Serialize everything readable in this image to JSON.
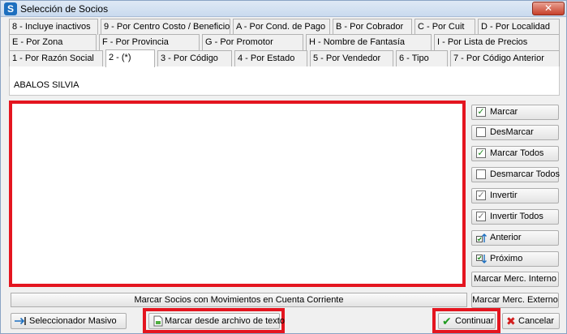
{
  "window": {
    "title": "Selección de Socios",
    "close_label": "✕"
  },
  "tabs": {
    "row1": [
      {
        "label": "8 - Incluye inactivos"
      },
      {
        "label": "9 - Por Centro Costo / Beneficio"
      },
      {
        "label": "A - Por Cond. de Pago"
      },
      {
        "label": "B - Por Cobrador"
      },
      {
        "label": "C - Por Cuit"
      },
      {
        "label": "D - Por Localidad"
      }
    ],
    "row2": [
      {
        "label": "E - Por Zona"
      },
      {
        "label": "F - Por Provincia"
      },
      {
        "label": "G - Por Promotor"
      },
      {
        "label": "H - Nombre de Fantasía"
      },
      {
        "label": "I - Por Lista de Precios"
      }
    ],
    "row3": [
      {
        "label": "1 - Por Razón Social"
      },
      {
        "label": "2 - (*)"
      },
      {
        "label": "3 - Por Código"
      },
      {
        "label": "4 - Por Estado"
      },
      {
        "label": "5 - Por Vendedor"
      },
      {
        "label": "6 - Tipo"
      },
      {
        "label": "7 - Por Código Anterior"
      }
    ]
  },
  "panel": {
    "value": "ABALOS SILVIA"
  },
  "side_buttons": {
    "marcar": "Marcar",
    "desmarcar": "DesMarcar",
    "marcar_todos": "Marcar Todos",
    "desmarcar_todos": "Desmarcar Todos",
    "invertir": "Invertir",
    "invertir_todos": "Invertir Todos",
    "anterior": "Anterior",
    "proximo": "Próximo",
    "marcar_merc_interno": "Marcar Merc. Interno",
    "marcar_merc_externo": "Marcar Merc. Externo"
  },
  "bottom": {
    "marcar_movimientos": "Marcar Socios con Movimientos en Cuenta Corriente",
    "seleccionador_masivo": "Seleccionador Masivo",
    "marcar_archivo": "Marcar desde archivo de texto",
    "continuar": "Continuar",
    "cancelar": "Cancelar"
  },
  "colors": {
    "highlight": "#e4151f",
    "accent": "#1d6fbf"
  },
  "icons": [
    "app-icon",
    "close-icon",
    "checkbox-icon",
    "arrow-up-icon",
    "arrow-down-icon",
    "arrow-right-icon",
    "file-icon",
    "checkmark-icon",
    "cross-icon"
  ]
}
